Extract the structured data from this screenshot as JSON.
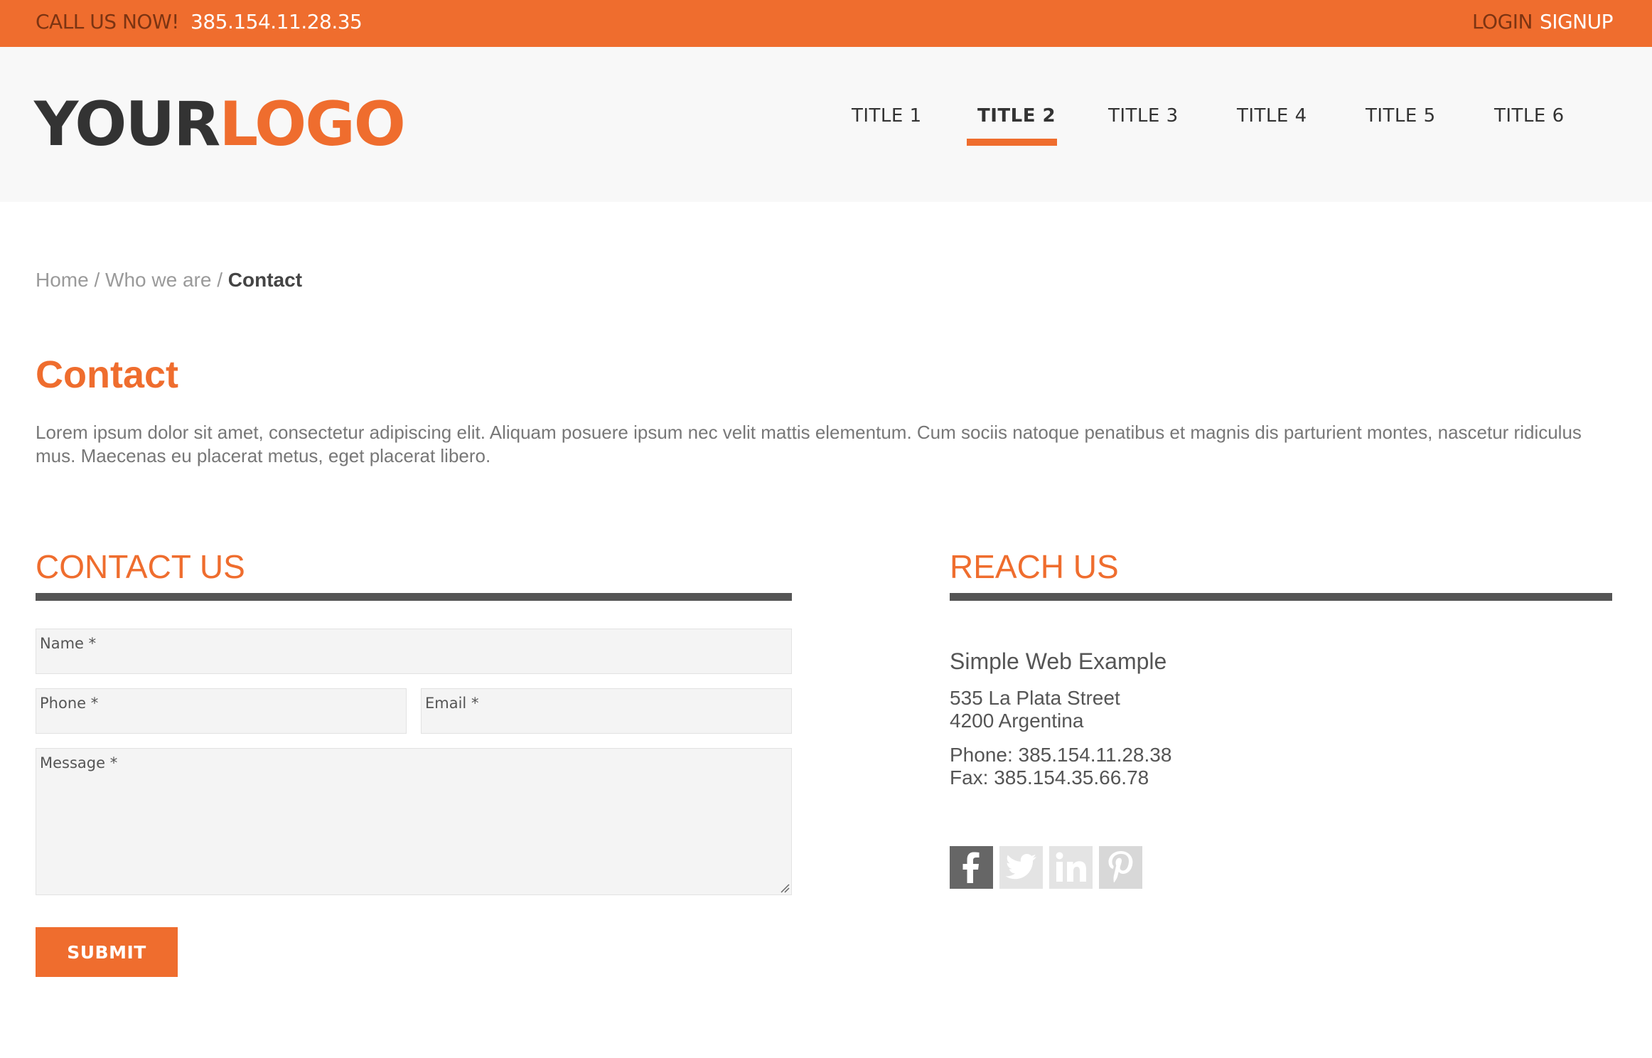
{
  "topbar": {
    "call_label": "CALL US NOW!",
    "phone": "385.154.11.28.35",
    "login": "LOGIN",
    "signup": "SIGNUP"
  },
  "logo": {
    "part1": "YOUR",
    "part2": "LOGO"
  },
  "nav": {
    "items": [
      {
        "label": "TITLE 1"
      },
      {
        "label": "TITLE 2",
        "active": true
      },
      {
        "label": "TITLE 3"
      },
      {
        "label": "TITLE 4"
      },
      {
        "label": "TITLE 5"
      },
      {
        "label": "TITLE 6"
      }
    ]
  },
  "breadcrumb": {
    "items": [
      "Home",
      "Who we are"
    ],
    "separator": "/",
    "current": "Contact"
  },
  "main": {
    "title": "Contact",
    "intro": "Lorem ipsum dolor sit amet, consectetur adipiscing elit. Aliquam posuere ipsum nec velit mattis elementum. Cum sociis natoque penatibus et magnis dis parturient montes, nascetur ridiculus mus. Maecenas eu placerat metus, eget placerat libero."
  },
  "contact_form": {
    "title": "CONTACT US",
    "name_label": "Name *",
    "phone_label": "Phone *",
    "email_label": "Email *",
    "message_label": "Message *",
    "submit_label": "SUBMIT"
  },
  "reach": {
    "title": "REACH US",
    "company": "Simple Web Example",
    "address_line1": "535 La Plata Street",
    "address_line2": "4200 Argentina",
    "phone": "Phone: 385.154.11.28.38",
    "fax": "Fax: 385.154.35.66.78",
    "social": [
      {
        "icon": "facebook-icon",
        "color": "#666666"
      },
      {
        "icon": "twitter-icon",
        "color": "#e4e4e4"
      },
      {
        "icon": "linkedin-icon",
        "color": "#e4e4e4"
      },
      {
        "icon": "pinterest-icon",
        "color": "#d8d8d8"
      }
    ]
  },
  "colors": {
    "accent": "#ef6d2e",
    "accent_dark": "#7c3412",
    "dark": "#333333",
    "header_bg": "#f8f8f8"
  }
}
